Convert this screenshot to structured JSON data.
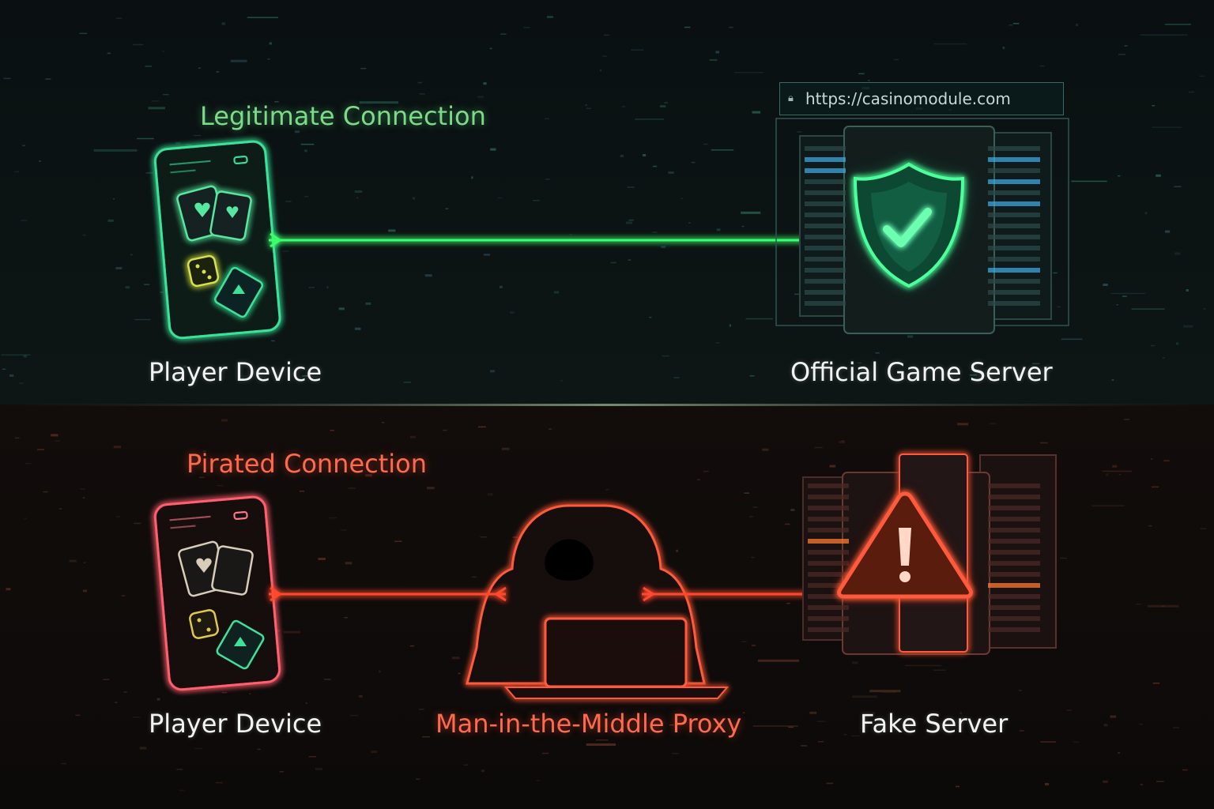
{
  "legit": {
    "title": "Legitimate Connection",
    "client_label": "Player Device",
    "server_label": "Official Game Server",
    "url": "https://casinomodule.com",
    "icons": [
      "phone-icon",
      "playing-cards-icon",
      "dice-icon",
      "shield-check-icon",
      "server-rack-icon",
      "lock-icon"
    ]
  },
  "pirated": {
    "title": "Pirated Connection",
    "client_label": "Player Device",
    "proxy_label": "Man-in-the-Middle Proxy",
    "server_label": "Fake Server",
    "icons": [
      "phone-icon",
      "playing-cards-icon",
      "dice-icon",
      "hooded-hacker-icon",
      "laptop-icon",
      "warning-triangle-icon",
      "server-rack-icon"
    ]
  },
  "colors": {
    "legit_accent": "#3dff6e",
    "pirated_accent": "#ff4a2e",
    "background": "#0b0f12"
  }
}
